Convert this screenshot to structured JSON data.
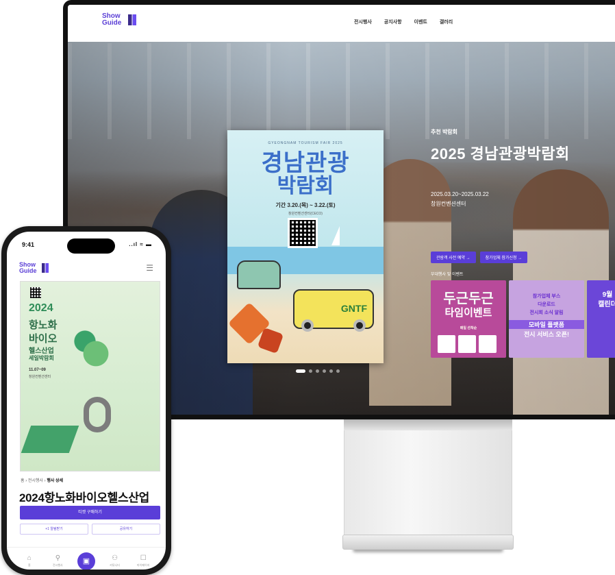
{
  "desktop": {
    "logo": "Show Guide",
    "nav": [
      "전시행사",
      "공지사항",
      "이벤트",
      "갤러리"
    ],
    "poster": {
      "small": "GYEONGNAM TOURISM FAIR 2025",
      "title_line1": "경남관광",
      "title_line2": "박람회",
      "dates": "기간 3.20.(목) ~ 3.22.(토)",
      "venue": "창원컨벤션센터(CECO)",
      "badge": "GNTF"
    },
    "hero": {
      "subtitle": "추천 박람회",
      "title": "2025 경남관광박람회",
      "dates": "2025.03.20~2025.03.22",
      "venue": "창원컨벤션센터",
      "button1": "관람객 사전 예약 →",
      "button2": "참가업체 참가신청 →",
      "events_heading": "부대행사 및 이벤트"
    },
    "cards": [
      {
        "line1": "두근두근",
        "line2": "타임이벤트",
        "note": "매일 선착순"
      },
      {
        "line1": "참가업체 부스",
        "line2": "다운로드",
        "line3": "전시회 소식 알림",
        "line4": "모바일 플랫폼",
        "line5": "전시 서비스 오픈!"
      },
      {
        "line1": "9월",
        "line2": "캘린더"
      }
    ]
  },
  "mobile": {
    "time": "9:41",
    "status": "..ıl ≈ ▬",
    "logo": "Show Guide",
    "menu_icon": "☰",
    "poster": {
      "year": "2024",
      "line1": "항노화",
      "line2": "바이오",
      "line3": "헬스산업",
      "line4": "세일박람회",
      "dates": "11.07~09",
      "venue": "창원컨벤션센터"
    },
    "breadcrumb_home": "홈",
    "breadcrumb_mid": "전시행사",
    "breadcrumb_current": "행사 상세",
    "title": "2024항노화바이오헬스산업",
    "primary_button": "티켓 구매하기",
    "secondary_left": "+1 알림받기",
    "secondary_right": "공유하기",
    "tabs": [
      {
        "icon": "⌂",
        "label": "홈"
      },
      {
        "icon": "⚲",
        "label": "전시행사"
      },
      {
        "icon": "▣",
        "label": ""
      },
      {
        "icon": "⚇",
        "label": "커뮤니티"
      },
      {
        "icon": "☐",
        "label": "마이페이지"
      }
    ]
  },
  "colors": {
    "accent": "#5a3ed8",
    "brand_logo": "#5b3fd6"
  }
}
